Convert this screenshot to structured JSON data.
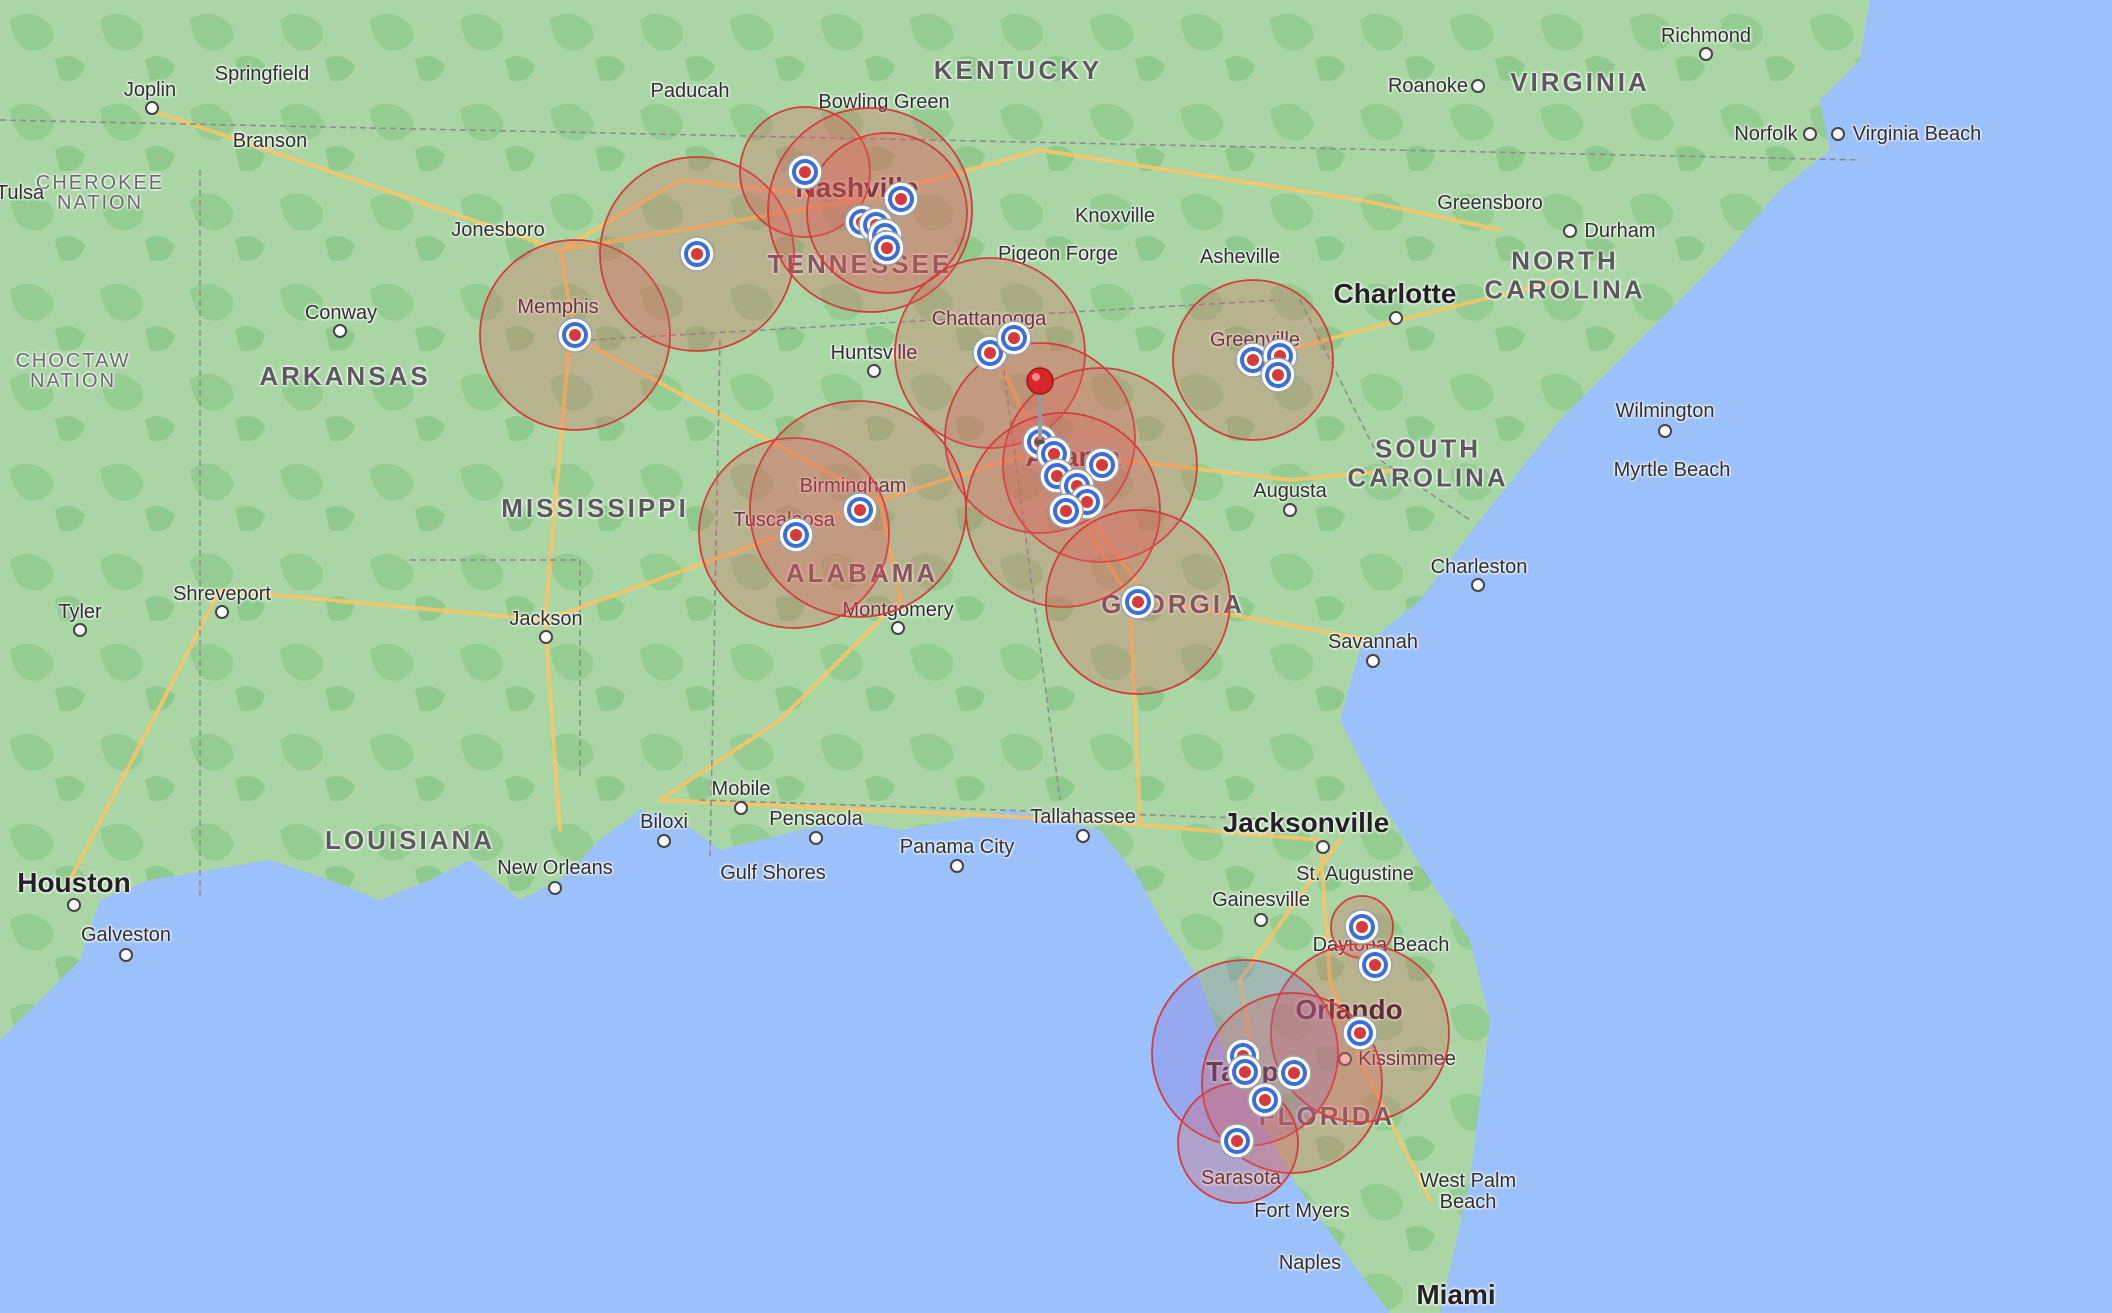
{
  "colors": {
    "ocean": "#9cc0f9",
    "land": "#a9d6a4",
    "forest": "#8cc98c",
    "road": "#f7c86a",
    "circle_fill": "#e05a5a",
    "circle_stroke": "#d43c3c",
    "pin": "#d92727"
  },
  "icons": {
    "marker": "target-marker-icon",
    "pin": "red-pushpin-icon"
  },
  "states": [
    {
      "name": "KENTUCKY"
    },
    {
      "name": "VIRGINIA"
    },
    {
      "name": "TENNESSEE"
    },
    {
      "name": "NORTH CAROLINA"
    },
    {
      "name": "ARKANSAS"
    },
    {
      "name": "SOUTH CAROLINA"
    },
    {
      "name": "MISSISSIPPI"
    },
    {
      "name": "ALABAMA"
    },
    {
      "name": "GEORGIA"
    },
    {
      "name": "LOUISIANA"
    },
    {
      "name": "FLORIDA"
    }
  ],
  "regions": [
    {
      "name": "CHEROKEE NATION"
    },
    {
      "name": "CHOCTAW NATION"
    }
  ],
  "cities": [
    {
      "name": "Joplin"
    },
    {
      "name": "Springfield"
    },
    {
      "name": "Paducah"
    },
    {
      "name": "Bowling Green"
    },
    {
      "name": "Richmond"
    },
    {
      "name": "Roanoke"
    },
    {
      "name": "Norfolk"
    },
    {
      "name": "Virginia Beach"
    },
    {
      "name": "Branson"
    },
    {
      "name": "Tulsa"
    },
    {
      "name": "Jonesboro"
    },
    {
      "name": "Nashville"
    },
    {
      "name": "Knoxville"
    },
    {
      "name": "Pigeon Forge"
    },
    {
      "name": "Asheville"
    },
    {
      "name": "Greensboro"
    },
    {
      "name": "Durham"
    },
    {
      "name": "Charlotte"
    },
    {
      "name": "Memphis"
    },
    {
      "name": "Conway"
    },
    {
      "name": "Chattanooga"
    },
    {
      "name": "Huntsville"
    },
    {
      "name": "Greenville"
    },
    {
      "name": "Wilmington"
    },
    {
      "name": "Atlanta"
    },
    {
      "name": "Birmingham"
    },
    {
      "name": "Augusta"
    },
    {
      "name": "Myrtle Beach"
    },
    {
      "name": "Tuscaloosa"
    },
    {
      "name": "Shreveport"
    },
    {
      "name": "Charleston"
    },
    {
      "name": "Tyler"
    },
    {
      "name": "Jackson"
    },
    {
      "name": "Montgomery"
    },
    {
      "name": "Savannah"
    },
    {
      "name": "Mobile"
    },
    {
      "name": "Biloxi"
    },
    {
      "name": "Pensacola"
    },
    {
      "name": "Tallahassee"
    },
    {
      "name": "Jacksonville"
    },
    {
      "name": "Panama City"
    },
    {
      "name": "New Orleans"
    },
    {
      "name": "Gulf Shores"
    },
    {
      "name": "St. Augustine"
    },
    {
      "name": "Houston"
    },
    {
      "name": "Gainesville"
    },
    {
      "name": "Galveston"
    },
    {
      "name": "Daytona Beach"
    },
    {
      "name": "Orlando"
    },
    {
      "name": "Kissimmee"
    },
    {
      "name": "Tampa"
    },
    {
      "name": "Sarasota"
    },
    {
      "name": "West Palm Beach"
    },
    {
      "name": "Fort Myers"
    },
    {
      "name": "Naples"
    },
    {
      "name": "Miami"
    }
  ]
}
